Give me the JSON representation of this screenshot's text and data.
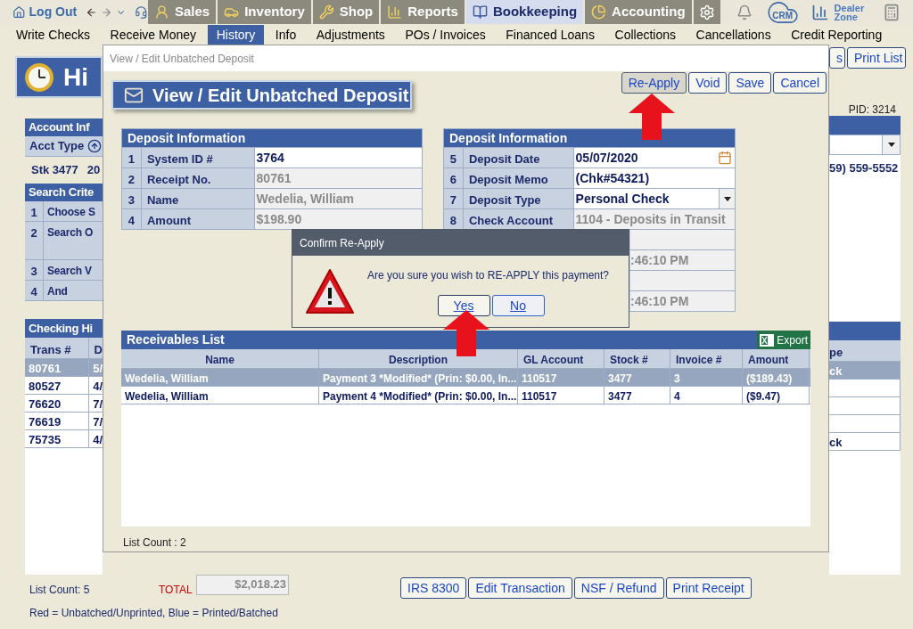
{
  "nav": {
    "logout": "Log Out",
    "tabs": [
      {
        "label": "Sales",
        "kind": "sales",
        "selected": false
      },
      {
        "label": "Inventory",
        "kind": "inventory",
        "selected": false
      },
      {
        "label": "Shop",
        "kind": "shop",
        "selected": false
      },
      {
        "label": "Reports",
        "kind": "reports",
        "selected": false
      },
      {
        "label": "Bookkeeping",
        "kind": "bookkeeping",
        "selected": true
      },
      {
        "label": "Accounting",
        "kind": "accounting",
        "selected": false
      }
    ],
    "crm": "CRM",
    "dealer_zone": [
      "Dealer",
      "Zone"
    ]
  },
  "subnav": [
    {
      "label": "Write Checks",
      "selected": false
    },
    {
      "label": "Receive Money",
      "selected": false
    },
    {
      "label": "History",
      "selected": true
    },
    {
      "label": "Info",
      "selected": false
    },
    {
      "label": "Adjustments",
      "selected": false
    },
    {
      "label": "POs / Invoices",
      "selected": false
    },
    {
      "label": "Financed Loans",
      "selected": false
    },
    {
      "label": "Collections",
      "selected": false
    },
    {
      "label": "Cancellations",
      "selected": false
    },
    {
      "label": "Credit Reporting",
      "selected": false
    }
  ],
  "page": {
    "title": "Hi",
    "account_info": {
      "title": "Account Inf",
      "row_label": "Acct Type"
    },
    "stock_line": [
      "Stk 3477",
      "20"
    ],
    "search_criteria": {
      "title": "Search Crite",
      "rows": [
        {
          "num": "1",
          "label": "Choose S",
          "kind": "single"
        },
        {
          "num": "2",
          "label": "Search O",
          "kind": "tall"
        },
        {
          "num": "3",
          "label": "Search V",
          "kind": "single"
        },
        {
          "num": "4",
          "label": "And",
          "kind": "single"
        }
      ]
    },
    "checking_history": {
      "title": "Checking Hi",
      "columns": [
        "Trans #",
        "D"
      ],
      "rows": [
        {
          "cells": [
            "80761",
            "5/"
          ],
          "selected": true
        },
        {
          "cells": [
            "80527",
            "4/"
          ],
          "selected": false
        },
        {
          "cells": [
            "76620",
            "7/"
          ],
          "selected": false
        },
        {
          "cells": [
            "76619",
            "7/"
          ],
          "selected": false
        },
        {
          "cells": [
            "75735",
            "4/"
          ],
          "selected": false
        }
      ]
    },
    "right": {
      "buttons": [
        "s",
        "Print List"
      ],
      "pid": "PID: 3214",
      "phone": "59) 559-5552",
      "column": "pe",
      "rows": [
        {
          "cell": "ck",
          "selected": true
        },
        {
          "selected": false
        },
        {
          "selected": false
        },
        {
          "selected": false
        },
        {
          "cell": "ck",
          "selected": false
        }
      ]
    }
  },
  "modal": {
    "title": "View / Edit Unbatched Deposit",
    "heading": "View / Edit Unbatched Deposit",
    "buttons": [
      {
        "label": "Re-Apply",
        "selected": true
      },
      {
        "label": "Void",
        "selected": false
      },
      {
        "label": "Save",
        "selected": false
      },
      {
        "label": "Cancel",
        "selected": false
      }
    ],
    "left_table": {
      "title": "Deposit Information",
      "rows": [
        {
          "num": "1",
          "label": "System ID #",
          "value": "3764",
          "kind": "input"
        },
        {
          "num": "2",
          "label": "Receipt No.",
          "value": "80761",
          "kind": "readonly"
        },
        {
          "num": "3",
          "label": "Name",
          "value": "Wedelia, William",
          "kind": "readonly"
        },
        {
          "num": "4",
          "label": "Amount",
          "value": "$198.90",
          "kind": "readonly"
        }
      ]
    },
    "right_table": {
      "title": "Deposit Information",
      "rows": [
        {
          "num": "5",
          "label": "Deposit Date",
          "value": "05/07/2020",
          "kind": "date"
        },
        {
          "num": "6",
          "label": "Deposit Memo",
          "value": " (Chk#54321)",
          "kind": "input"
        },
        {
          "num": "7",
          "label": "Deposit Type",
          "value": "Personal Check",
          "kind": "select"
        },
        {
          "num": "8",
          "label": "Check Account",
          "value": "1104 - Deposits in Transit",
          "kind": "readonly"
        },
        {
          "kind": "covered"
        },
        {
          "value": ":46:10 PM",
          "kind": "covered"
        },
        {
          "kind": "covered"
        },
        {
          "value": ":46:10 PM",
          "kind": "covered"
        }
      ]
    },
    "receivables": {
      "title": "Receivables List",
      "export": "Export",
      "columns": [
        "Name",
        "Description",
        "GL Account",
        "Stock #",
        "Invoice #",
        "Amount"
      ],
      "rows": [
        {
          "selected": true,
          "cells": [
            "Wedelia, William",
            "Payment 3 *Modified* (Prin: $0.00, In...",
            "110517",
            "3477",
            "3",
            "($189.43)"
          ]
        },
        {
          "selected": false,
          "cells": [
            "Wedelia, William",
            "Payment 4 *Modified* (Prin: $0.00, In...",
            "110517",
            "3477",
            "4",
            "($9.47)"
          ]
        }
      ]
    },
    "list_count": "List Count : 2"
  },
  "dialog": {
    "title": "Confirm Re-Apply",
    "message": "Are you sure you wish to RE-APPLY this payment?",
    "buttons": [
      {
        "label": "Yes",
        "selected": true
      },
      {
        "label": "No",
        "selected": false
      }
    ]
  },
  "footer": {
    "list_count": "List Count: 5",
    "total_label": "TOTAL",
    "total": "$2,018.23",
    "buttons": [
      "IRS 8300",
      "Edit Transaction",
      "NSF / Refund",
      "Print Receipt"
    ],
    "legend": "Red = Unbatched/Unprinted, Blue = Printed/Batched"
  }
}
